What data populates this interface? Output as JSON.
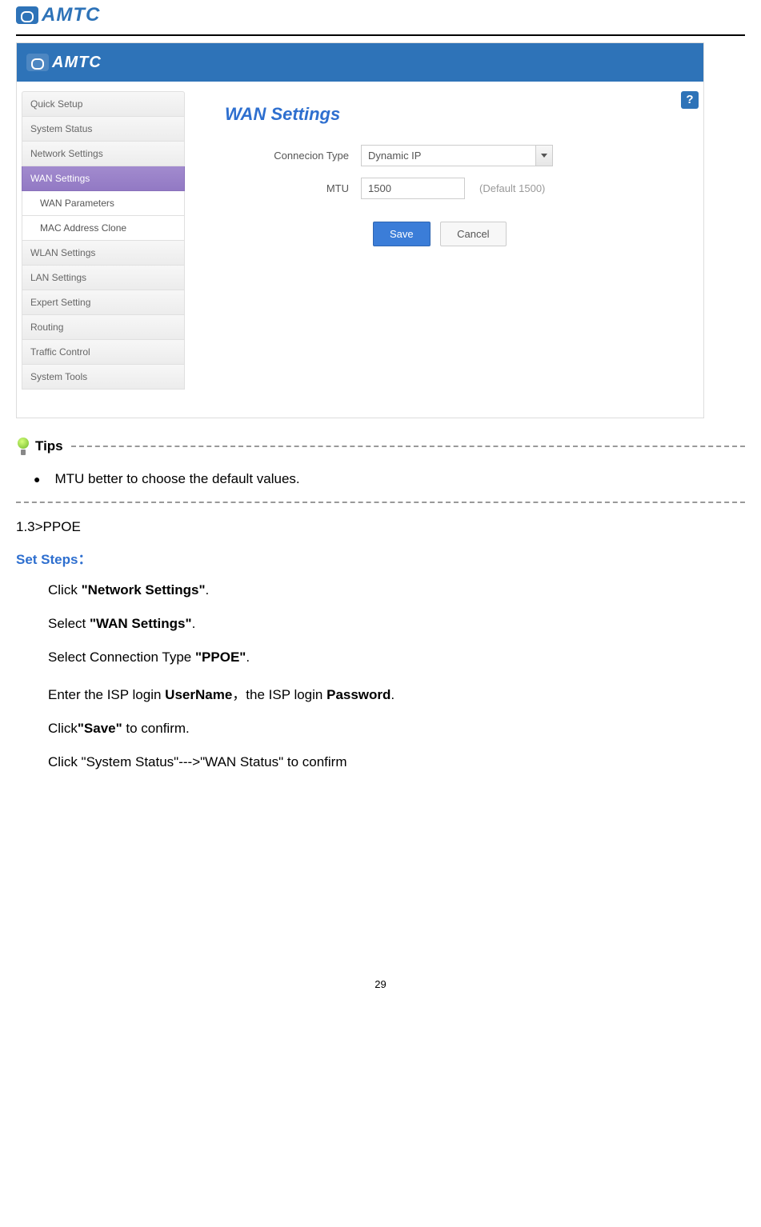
{
  "logo_text": "AMTC",
  "screenshot": {
    "help_icon": "?",
    "sidebar": {
      "items": [
        {
          "label": "Quick Setup",
          "active": false
        },
        {
          "label": "System Status",
          "active": false
        },
        {
          "label": "Network Settings",
          "active": false
        },
        {
          "label": "WAN Settings",
          "active": true
        },
        {
          "label": "WLAN Settings",
          "active": false
        },
        {
          "label": "LAN Settings",
          "active": false
        },
        {
          "label": "Expert Setting",
          "active": false
        },
        {
          "label": "Routing",
          "active": false
        },
        {
          "label": "Traffic Control",
          "active": false
        },
        {
          "label": "System Tools",
          "active": false
        }
      ],
      "submenu": [
        {
          "label": "WAN Parameters"
        },
        {
          "label": "MAC Address Clone"
        }
      ]
    },
    "content": {
      "title": "WAN Settings",
      "rows": {
        "connection_type_label": "Connecion Type",
        "connection_type_value": "Dynamic IP",
        "mtu_label": "MTU",
        "mtu_value": "1500",
        "mtu_hint": "(Default 1500)"
      },
      "buttons": {
        "save": "Save",
        "cancel": "Cancel"
      }
    }
  },
  "tips": {
    "heading": "Tips",
    "bullet": "MTU better to choose the default values."
  },
  "section": {
    "heading": "1.3>PPOE",
    "set_steps": "Set Steps：",
    "steps": [
      {
        "pre": "Click ",
        "bold": "\"Network Settings\"",
        "post": "."
      },
      {
        "pre": "Select ",
        "bold": "\"WAN Settings\"",
        "post": "."
      },
      {
        "pre": "Select Connection Type ",
        "bold": "\"PPOE\"",
        "post": "."
      },
      {
        "pre": "Enter the ISP login ",
        "bold": "UserName",
        "mid": "，the ISP login ",
        "bold2": "Password",
        "post": "."
      },
      {
        "pre": "Click",
        "bold": "\"Save\"",
        "post": " to confirm."
      },
      {
        "pre": "Click \"System Status\"--->\"WAN Status\" to confirm",
        "bold": "",
        "post": ""
      }
    ]
  },
  "page_number": "29"
}
